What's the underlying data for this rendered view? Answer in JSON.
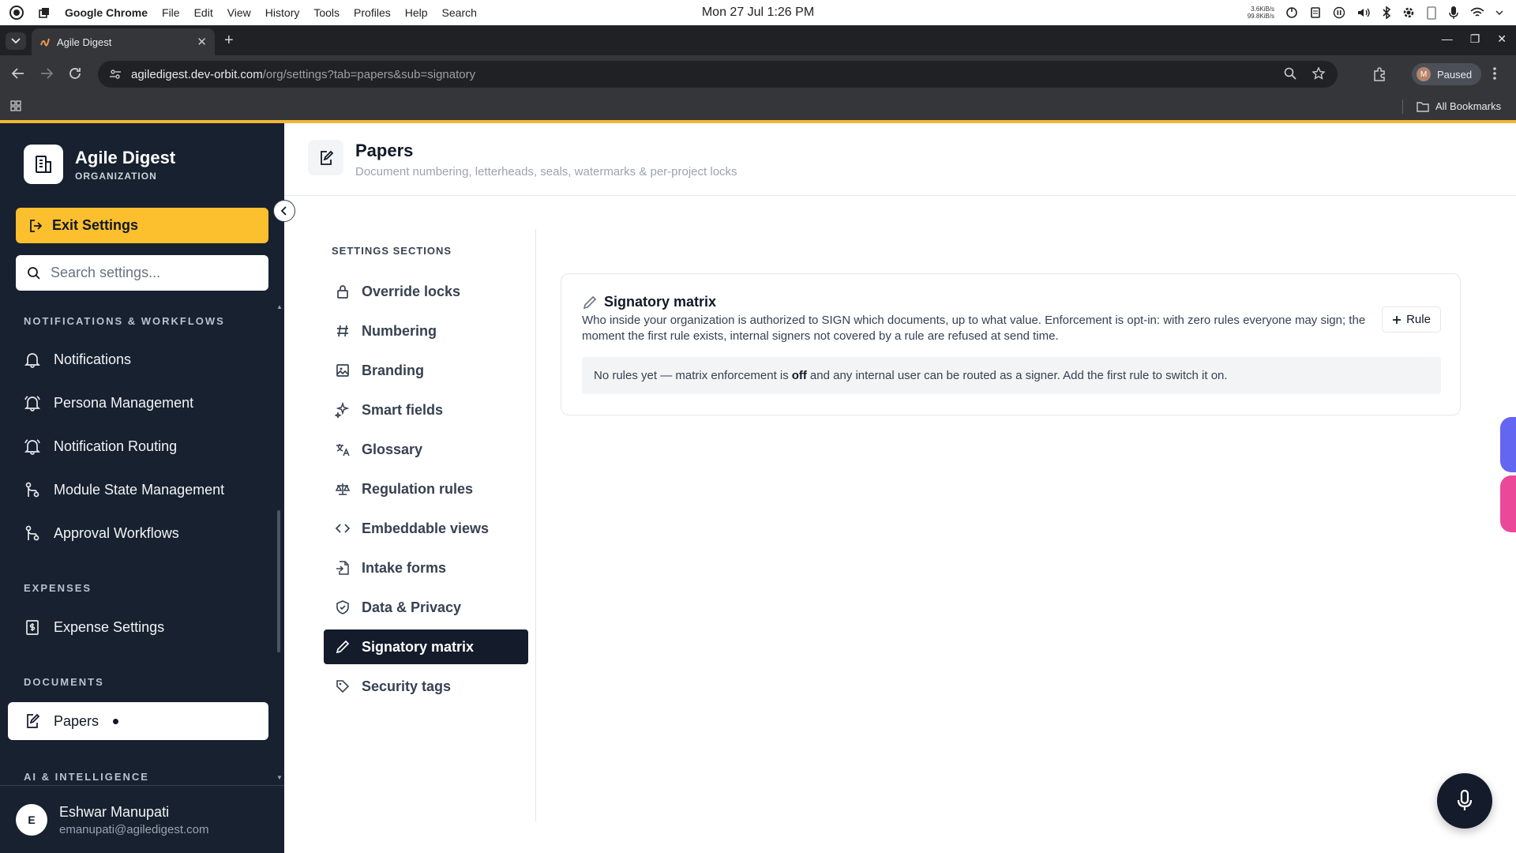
{
  "os_bar": {
    "app_name": "Google Chrome",
    "menus": [
      "File",
      "Edit",
      "View",
      "History",
      "Tools",
      "Profiles",
      "Help",
      "Search"
    ],
    "clock": "Mon 27 Jul  1:26 PM",
    "net_up": "3.6KiB/s",
    "net_down": "99.8KiB/s"
  },
  "browser": {
    "tab_title": "Agile Digest",
    "url_host": "agiledigest.dev-orbit.com",
    "url_rest": "/org/settings?tab=papers&sub=signatory",
    "profile_initial": "M",
    "profile_status": "Paused",
    "bookmarks_label": "All Bookmarks"
  },
  "sidebar": {
    "org_name": "Agile Digest",
    "org_sub": "ORGANIZATION",
    "exit_label": "Exit Settings",
    "search_placeholder": "Search settings...",
    "sections": {
      "notifications": "NOTIFICATIONS & WORKFLOWS",
      "expenses": "EXPENSES",
      "documents": "DOCUMENTS",
      "ai": "AI & INTELLIGENCE"
    },
    "items": {
      "notifications": "Notifications",
      "persona": "Persona Management",
      "routing": "Notification Routing",
      "module_state": "Module State Management",
      "approval": "Approval Workflows",
      "expense_settings": "Expense Settings",
      "papers": "Papers"
    },
    "user": {
      "initial": "E",
      "name": "Eshwar Manupati",
      "email": "emanupati@agiledigest.com"
    }
  },
  "main": {
    "title": "Papers",
    "subtitle": "Document numbering, letterheads, seals, watermarks & per-project locks",
    "sections_label": "SETTINGS SECTIONS",
    "sections": {
      "override_locks": "Override locks",
      "numbering": "Numbering",
      "branding": "Branding",
      "smart_fields": "Smart fields",
      "glossary": "Glossary",
      "regulation_rules": "Regulation rules",
      "embeddable_views": "Embeddable views",
      "intake_forms": "Intake forms",
      "data_privacy": "Data & Privacy",
      "signatory_matrix": "Signatory matrix",
      "security_tags": "Security tags"
    },
    "card": {
      "title": "Signatory matrix",
      "description": "Who inside your organization is authorized to SIGN which documents, up to what value. Enforcement is opt-in: with zero rules everyone may sign; the moment the first rule exists, internal signers not covered by a rule are refused at send time.",
      "rule_button": "Rule",
      "notice_before": "No rules yet — matrix enforcement is",
      "notice_bold": "off",
      "notice_after": "and any internal user can be routed as a signer. Add the first rule to switch it on."
    }
  },
  "colors": {
    "accent": "#fcbf2e",
    "sidebar_bg": "#17212f",
    "active_section": "#141b2b"
  }
}
